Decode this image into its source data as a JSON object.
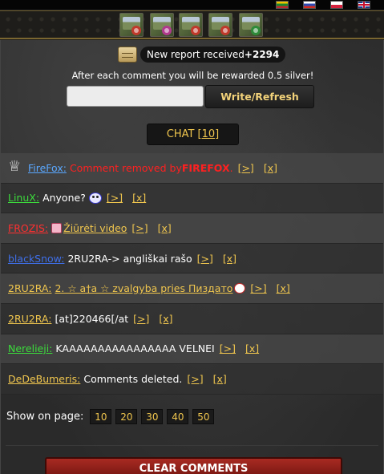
{
  "flags": [
    {
      "name": "lithuanian-flag-icon"
    },
    {
      "name": "russian-flag-icon"
    },
    {
      "name": "polish-flag-icon"
    },
    {
      "name": "english-flag-icon"
    }
  ],
  "game_icons": [
    {
      "name": "game-icon-1",
      "bug_color": "#c0392b"
    },
    {
      "name": "game-icon-2",
      "bug_color": "#b0398d"
    },
    {
      "name": "game-icon-3",
      "bug_color": "#c0392b"
    },
    {
      "name": "game-icon-4",
      "bug_color": "#c0392b"
    },
    {
      "name": "game-icon-5",
      "bug_color": "#2e8b3a"
    }
  ],
  "report": {
    "label": "New report received",
    "amount": "+2294"
  },
  "reward_text": "After each comment you will be rewarded 0.5 silver!",
  "comment_input": {
    "value": "",
    "placeholder": ""
  },
  "write_button": "Write/Refresh",
  "chat": {
    "label": "CHAT",
    "count": "[10]"
  },
  "messages": [
    {
      "user": "FireFox:",
      "user_color": "#5aa8ff",
      "text": "Comment removed by ",
      "text2": "FIREFOX",
      "text3": ".",
      "text_color": "#ff2020",
      "crown": true
    },
    {
      "user": "LinuX:",
      "user_color": "#3cdc3c",
      "text": "Anyone?",
      "smile": true
    },
    {
      "user": "FROZIS:",
      "user_color": "#ff3030",
      "text": "Žiūrėti video",
      "text_color": "#f0c64e",
      "video": true
    },
    {
      "user": "blackSnow:",
      "user_color": "#3f6fe8",
      "text": "2RU2RA-> angliškai rašo"
    },
    {
      "user": "2RU2RA:",
      "user_color": "#f0c64e",
      "text": "2. ☆ a†a ☆ zvalgyba  pries Пиздато",
      "text_color": "#f0c64e",
      "pig": true
    },
    {
      "user": "2RU2RA:",
      "user_color": "#f0c64e",
      "text": "[at]220466[/at"
    },
    {
      "user": "Nerelieji:",
      "user_color": "#3cdc3c",
      "text": "KAAAAAAAAAAAAAAAA VELNEI"
    },
    {
      "user": "DeDeBumeris:",
      "user_color": "#f0c64e",
      "text": "Comments deleted."
    }
  ],
  "actions": {
    "open": "[>]",
    "delete": "[x]"
  },
  "pager": {
    "label": "Show on page:",
    "options": [
      "10",
      "20",
      "30",
      "40",
      "50"
    ]
  },
  "clear_button": "CLEAR COMMENTS"
}
